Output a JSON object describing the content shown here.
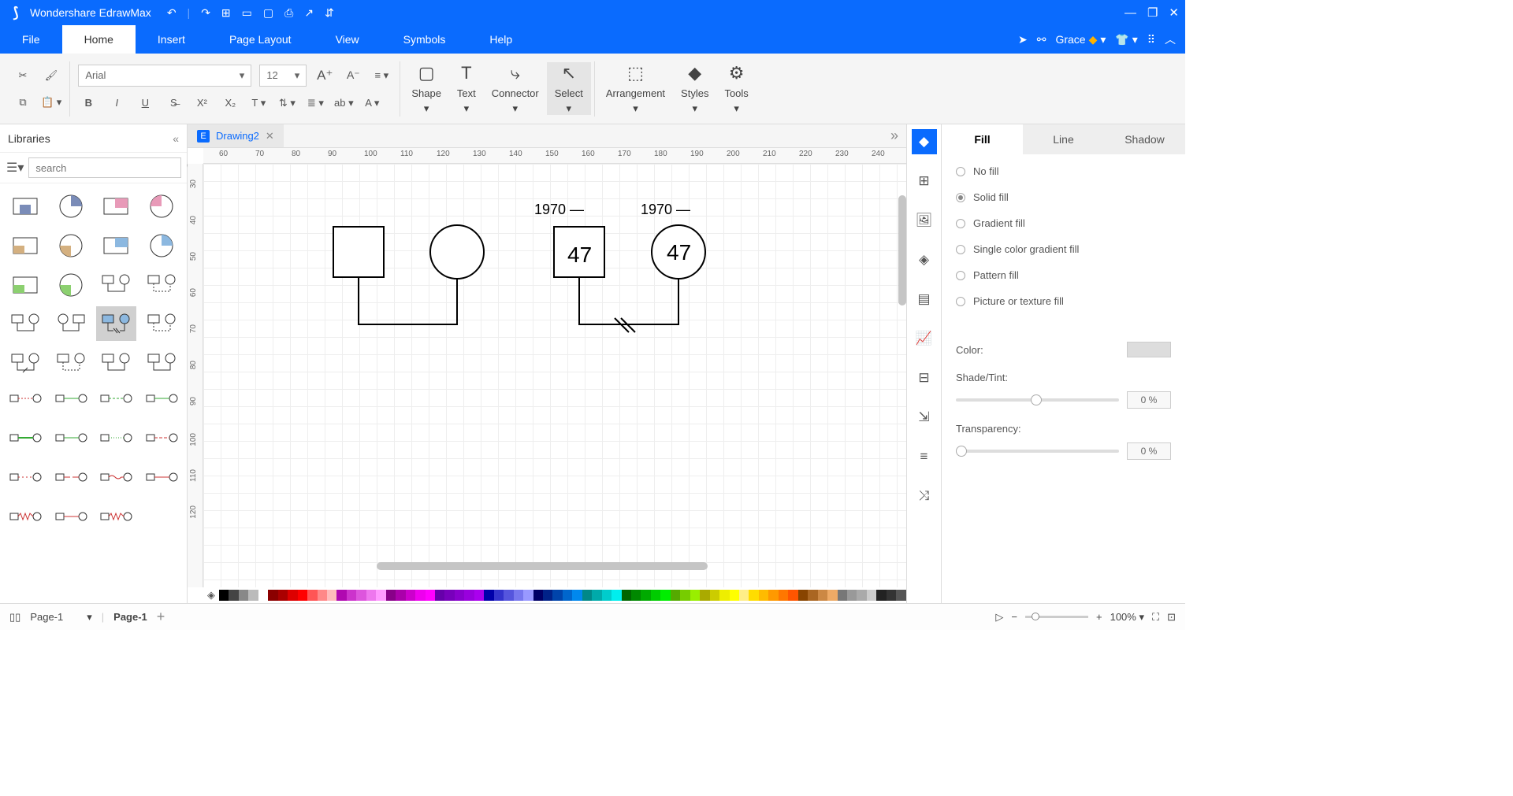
{
  "app": {
    "title": "Wondershare EdrawMax"
  },
  "qat": {
    "undo": "↶",
    "redo": "↷",
    "new": "⊞",
    "open": "▭",
    "save": "▢",
    "print": "⎙",
    "export": "↗",
    "more": "⇵"
  },
  "window_controls": {
    "min": "—",
    "max": "❐",
    "close": "✕"
  },
  "menu": {
    "items": [
      "File",
      "Home",
      "Insert",
      "Page Layout",
      "View",
      "Symbols",
      "Help"
    ],
    "active": 1,
    "user": "Grace"
  },
  "ribbon": {
    "font_name": "Arial",
    "font_size": "12",
    "groups": {
      "shape": "Shape",
      "text": "Text",
      "connector": "Connector",
      "select": "Select",
      "arrangement": "Arrangement",
      "styles": "Styles",
      "tools": "Tools"
    }
  },
  "libraries": {
    "title": "Libraries",
    "search_placeholder": "search"
  },
  "doc": {
    "tab_name": "Drawing2"
  },
  "ruler_h": [
    "60",
    "70",
    "80",
    "90",
    "100",
    "110",
    "120",
    "130",
    "140",
    "150",
    "160",
    "170",
    "180",
    "190",
    "200",
    "210",
    "220",
    "230",
    "240"
  ],
  "ruler_v": [
    "30",
    "40",
    "50",
    "60",
    "70",
    "80",
    "90",
    "100",
    "110",
    "120"
  ],
  "canvas": {
    "pair1": {
      "year": "1970 —"
    },
    "pair2": {
      "year": "1970 —",
      "age_sq": "47",
      "age_ci": "47"
    }
  },
  "proptabs": {
    "fill": "Fill",
    "line": "Line",
    "shadow": "Shadow",
    "active": 0
  },
  "fill": {
    "options": [
      "No fill",
      "Solid fill",
      "Gradient fill",
      "Single color gradient fill",
      "Pattern fill",
      "Picture or texture fill"
    ],
    "selected": 1,
    "color_label": "Color:",
    "shade_label": "Shade/Tint:",
    "shade_value": "0 %",
    "trans_label": "Transparency:",
    "trans_value": "0 %"
  },
  "status": {
    "page_select": "Page-1",
    "page_tab": "Page-1",
    "zoom": "100%"
  },
  "colors": [
    "#000",
    "#444",
    "#888",
    "#bbb",
    "#fff",
    "#8b0000",
    "#a00",
    "#d00",
    "#f00",
    "#f55",
    "#f88",
    "#fbb",
    "#b008b0",
    "#c3c",
    "#d5d",
    "#e7e",
    "#f9f",
    "#808",
    "#a0a",
    "#c0c",
    "#e0e",
    "#f0f",
    "#60a",
    "#70b",
    "#80c",
    "#90d",
    "#a0e",
    "#00a",
    "#33c",
    "#55d",
    "#77e",
    "#99f",
    "#006",
    "#028",
    "#04a",
    "#06c",
    "#08e",
    "#088",
    "#0aa",
    "#0cc",
    "#0ee",
    "#060",
    "#080",
    "#0a0",
    "#0c0",
    "#0e0",
    "#5a0",
    "#7c0",
    "#9e0",
    "#aa0",
    "#cc0",
    "#ee0",
    "#ff0",
    "#fe8",
    "#fd0",
    "#fb0",
    "#f90",
    "#f70",
    "#f50",
    "#840",
    "#a62",
    "#c84",
    "#ea6",
    "#777",
    "#999",
    "#aaa",
    "#ccc",
    "#222",
    "#333",
    "#555"
  ]
}
